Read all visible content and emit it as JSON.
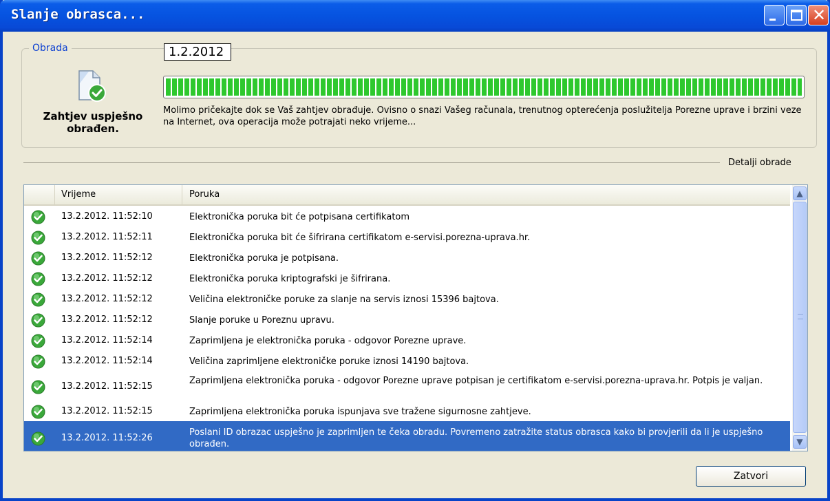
{
  "window": {
    "title": "Slanje obrasca..."
  },
  "processing": {
    "legend": "Obrada",
    "date": "1.2.2012",
    "status_label": "Zahtjev uspješno obrađen.",
    "progress_percent": 100,
    "progress_color": "#2ec82e",
    "message": "Molimo pričekajte dok se Vaš zahtjev obrađuje. Ovisno o snazi Vašeg računala, trenutnog opterećenja poslužitelja Porezne uprave i brzini veze na Internet, ova operacija može potrajati neko vrijeme..."
  },
  "details": {
    "label": "Detalji obrade"
  },
  "list": {
    "columns": [
      "Vrijeme",
      "Poruka"
    ],
    "rows": [
      {
        "time": "13.2.2012. 11:52:10",
        "message": "Elektronička poruka bit će potpisana certifikatom"
      },
      {
        "time": "13.2.2012. 11:52:11",
        "message": "Elektronička poruka bit će šifrirana certifikatom e-servisi.porezna-uprava.hr."
      },
      {
        "time": "13.2.2012. 11:52:12",
        "message": "Elektronička poruka je potpisana."
      },
      {
        "time": "13.2.2012. 11:52:12",
        "message": "Elektronička poruka kriptografski je šifrirana."
      },
      {
        "time": "13.2.2012. 11:52:12",
        "message": "Veličina elektroničke poruke za slanje na servis iznosi 15396 bajtova."
      },
      {
        "time": "13.2.2012. 11:52:12",
        "message": "Slanje poruke u Poreznu upravu."
      },
      {
        "time": "13.2.2012. 11:52:14",
        "message": "Zaprimljena je elektronička poruka - odgovor Porezne uprave."
      },
      {
        "time": "13.2.2012. 11:52:14",
        "message": "Veličina zaprimljene elektroničke poruke iznosi 14190 bajtova."
      },
      {
        "time": "13.2.2012. 11:52:15",
        "message": "Zaprimljena elektronička poruka - odgovor Porezne uprave potpisan je certifikatom e-servisi.porezna-uprava.hr. Potpis je valjan."
      },
      {
        "time": "13.2.2012. 11:52:15",
        "message": "Zaprimljena elektronička poruka ispunjava sve tražene sigurnosne zahtjeve."
      },
      {
        "time": "13.2.2012. 11:52:26",
        "message": "Poslani ID obrazac uspješno je zaprimljen te čeka obradu. Povremeno zatražite status obrasca kako bi provjerili da li je uspješno obrađen.",
        "selected": true
      }
    ],
    "row_icon": "check-circle-icon",
    "selection_color": "#316ac5"
  },
  "footer": {
    "close_label": "Zatvori"
  }
}
